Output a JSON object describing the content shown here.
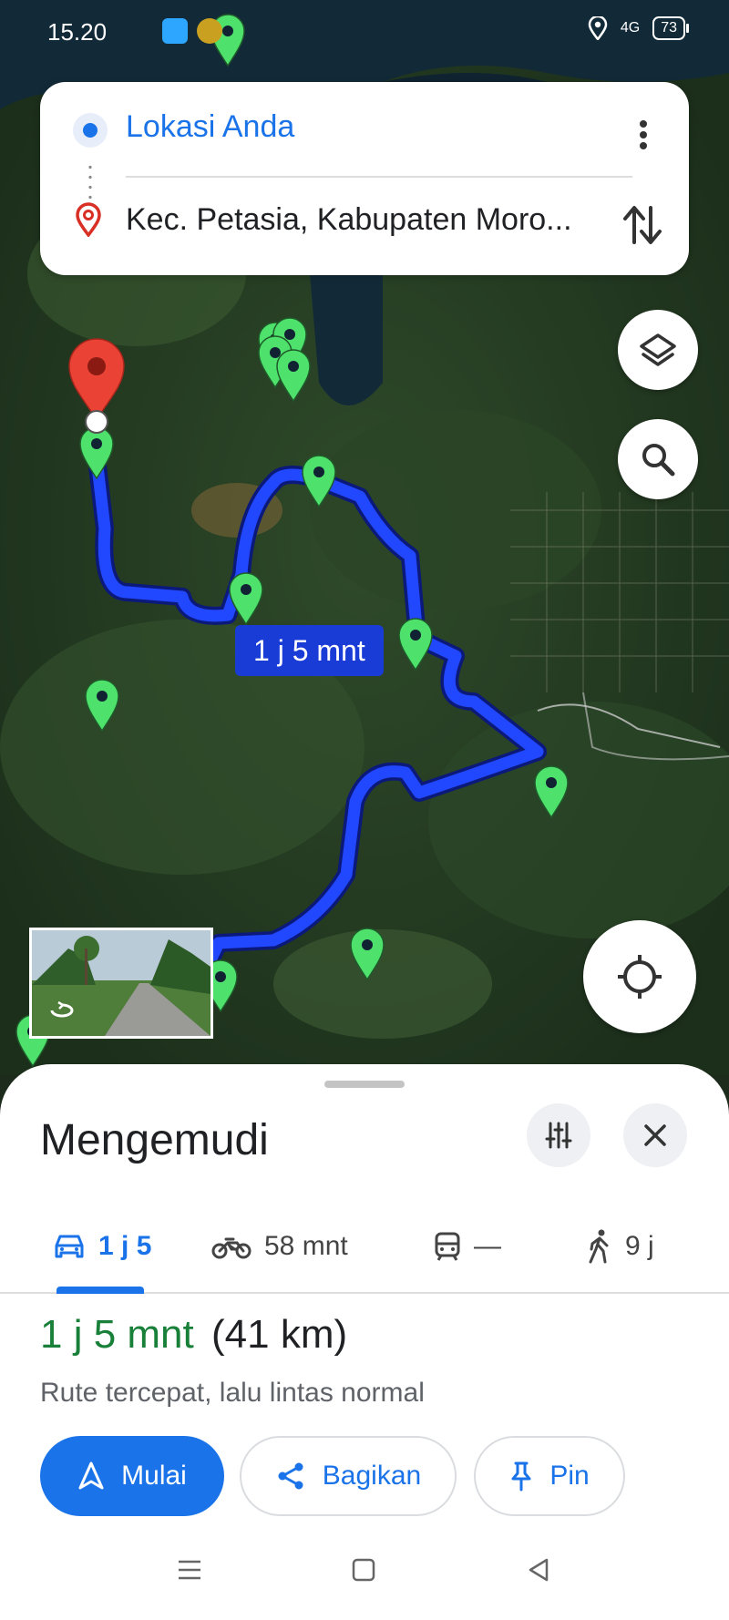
{
  "status_bar": {
    "time": "15.20",
    "network": "4G",
    "battery": "73"
  },
  "search": {
    "origin": "Lokasi Anda",
    "destination": "Kec. Petasia, Kabupaten Moro..."
  },
  "map": {
    "eta_label": "1 j 5 mnt",
    "route_color": "#1a3cd6",
    "marker_color": "#4ee26c"
  },
  "sheet": {
    "title": "Mengemudi",
    "tabs": [
      {
        "icon": "car-icon",
        "label": "1 j 5"
      },
      {
        "icon": "motorcycle-icon",
        "label": "58 mnt"
      },
      {
        "icon": "train-icon",
        "label": "—"
      },
      {
        "icon": "walk-icon",
        "label": "9 j"
      }
    ],
    "route_time": "1 j 5 mnt",
    "route_distance": "(41 km)",
    "route_description": "Rute tercepat, lalu lintas normal",
    "buttons": {
      "start": "Mulai",
      "share": "Bagikan",
      "pin": "Pin"
    }
  },
  "colors": {
    "accent": "#1a73e8",
    "eta_green": "#188038"
  }
}
